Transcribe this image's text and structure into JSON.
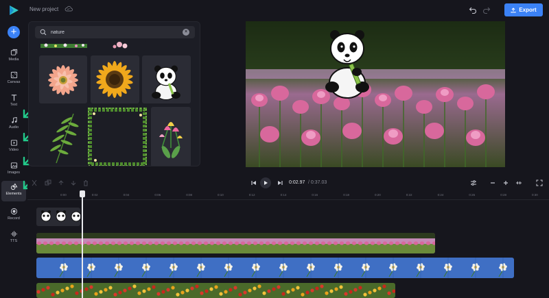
{
  "app": {
    "project_name": "New project",
    "export_label": "Export",
    "accent": "#3b82f6",
    "arrow_color": "#22c98a"
  },
  "rail": {
    "items": [
      {
        "label": "Media",
        "icon": "media-icon"
      },
      {
        "label": "Canvas",
        "icon": "canvas-icon"
      },
      {
        "label": "Text",
        "icon": "text-icon"
      },
      {
        "label": "Audio",
        "icon": "music-note-icon"
      },
      {
        "label": "Video",
        "icon": "video-icon"
      },
      {
        "label": "Images",
        "icon": "image-icon"
      },
      {
        "label": "Elements",
        "icon": "shapes-icon",
        "active": true
      },
      {
        "label": "Record",
        "icon": "record-icon"
      },
      {
        "label": "TTS",
        "icon": "waveform-icon"
      }
    ]
  },
  "search": {
    "value": "nature"
  },
  "elements_grid": [
    "flower-border-strip",
    "pink-blossom-strip",
    "pink-gerbera-daisy",
    "sunflower",
    "panda-with-bamboo",
    "fern-leaf",
    "leafy-frame",
    "tulip-bouquet"
  ],
  "player": {
    "current_time": "0:02.97",
    "total_time": "/ 0:37.03"
  },
  "ruler": {
    "ticks": [
      "0:00",
      "0:02",
      "0:04",
      "0:06",
      "0:08",
      "0:10",
      "0:12",
      "0:14",
      "0:16",
      "0:18",
      "0:20",
      "0:22",
      "0:24",
      "0:26",
      "0:28",
      "0:30",
      "0:32"
    ]
  },
  "tracks": [
    {
      "name": "panda-element-track",
      "color": "#2a2b33"
    },
    {
      "name": "pink-flower-field-track",
      "color": "#6a3a62"
    },
    {
      "name": "white-flowers-blue-track",
      "color": "#3f6fc4"
    },
    {
      "name": "red-yellow-flowers-track",
      "color": "#4a6a2a"
    }
  ]
}
